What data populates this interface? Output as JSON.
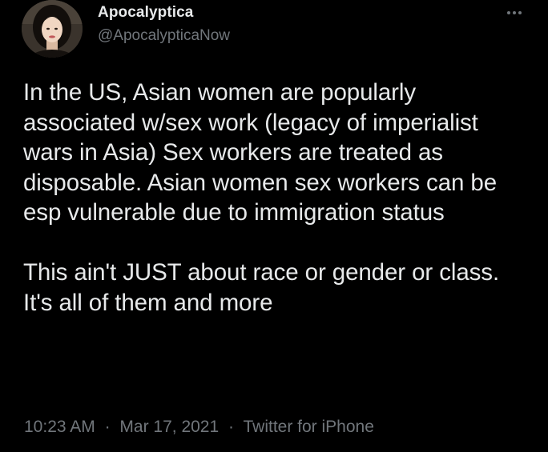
{
  "author": {
    "display_name": "Apocalyptica",
    "handle": "@ApocalypticaNow"
  },
  "tweet": {
    "paragraphs": [
      "In the US, Asian women are popularly associated w/sex work (legacy of imperialist wars in Asia) Sex workers are treated as disposable. Asian women sex workers can be esp vulnerable due to immigration status",
      "This ain't JUST about race or gender or class. It's all of them and more"
    ]
  },
  "meta": {
    "time": "10:23 AM",
    "separator": "·",
    "date": "Mar 17, 2021",
    "source": "Twitter for iPhone"
  },
  "icons": {
    "more": "more-horizontal-icon"
  },
  "colors": {
    "background": "#000000",
    "primary_text": "#e7e9ea",
    "secondary_text": "#71767b"
  }
}
